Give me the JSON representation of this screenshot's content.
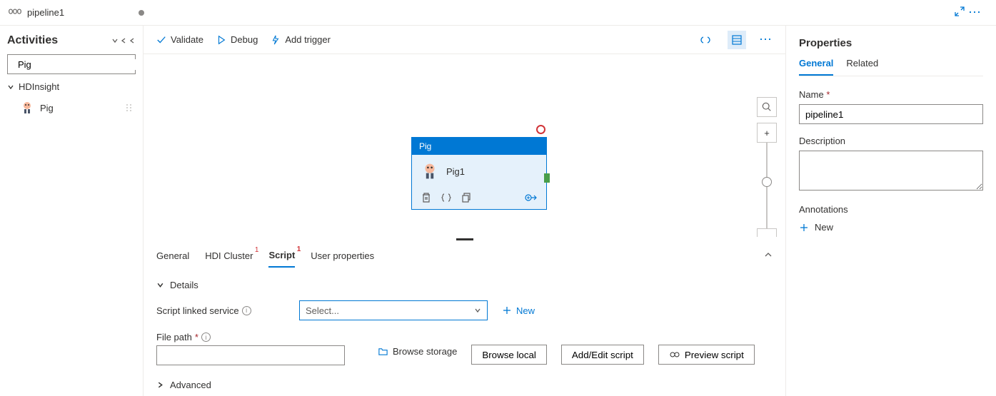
{
  "tab": {
    "title": "pipeline1"
  },
  "sidebar": {
    "title": "Activities",
    "search_value": "Pig",
    "category": "HDInsight",
    "item": "Pig"
  },
  "toolbar": {
    "validate": "Validate",
    "debug": "Debug",
    "add_trigger": "Add trigger"
  },
  "node": {
    "type": "Pig",
    "name": "Pig1"
  },
  "details": {
    "tabs": {
      "general": "General",
      "hdi": "HDI Cluster",
      "script": "Script",
      "user_props": "User properties"
    },
    "badge": "1",
    "section_title": "Details",
    "script_linked_label": "Script linked service",
    "select_placeholder": "Select...",
    "new_label": "New",
    "file_path_label": "File path",
    "browse_storage": "Browse storage",
    "browse_local": "Browse local",
    "add_edit_script": "Add/Edit script",
    "preview_script": "Preview script",
    "advanced": "Advanced"
  },
  "properties": {
    "title": "Properties",
    "tab_general": "General",
    "tab_related": "Related",
    "name_label": "Name",
    "name_value": "pipeline1",
    "description_label": "Description",
    "description_value": "",
    "annotations_label": "Annotations",
    "new_label": "New"
  }
}
